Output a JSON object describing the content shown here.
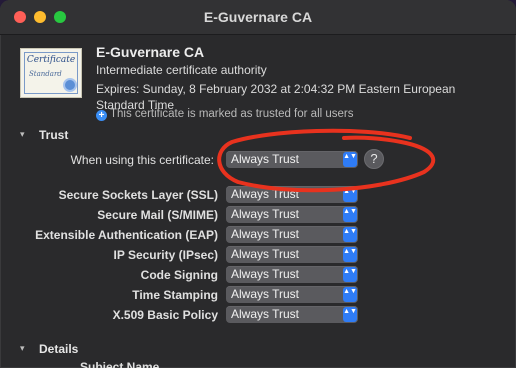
{
  "window": {
    "title": "E-Guvernare CA"
  },
  "certificate": {
    "icon_line1": "Certificate",
    "icon_line2": "Standard",
    "name": "E-Guvernare CA",
    "kind": "Intermediate certificate authority",
    "expires": "Expires: Sunday, 8 February 2032 at 2:04:32 PM Eastern European Standard Time",
    "trusted_note": "This certificate is marked as trusted for all users"
  },
  "trust": {
    "section_label": "Trust",
    "when_using_label": "When using this certificate:",
    "when_using_value": "Always Trust",
    "help_glyph": "?",
    "rows": [
      {
        "label": "Secure Sockets Layer (SSL)",
        "value": "Always Trust"
      },
      {
        "label": "Secure Mail (S/MIME)",
        "value": "Always Trust"
      },
      {
        "label": "Extensible Authentication (EAP)",
        "value": "Always Trust"
      },
      {
        "label": "IP Security (IPsec)",
        "value": "Always Trust"
      },
      {
        "label": "Code Signing",
        "value": "Always Trust"
      },
      {
        "label": "Time Stamping",
        "value": "Always Trust"
      },
      {
        "label": "X.509 Basic Policy",
        "value": "Always Trust"
      }
    ]
  },
  "details": {
    "section_label": "Details",
    "first_field": "Subject Name"
  },
  "icons": {
    "plus": "+",
    "popup_arrows": "▲▼",
    "disclosure": "▾"
  },
  "colors": {
    "accent": "#2f7cf6",
    "annotation": "#e8321e",
    "window_bg": "#2a2a2c"
  }
}
